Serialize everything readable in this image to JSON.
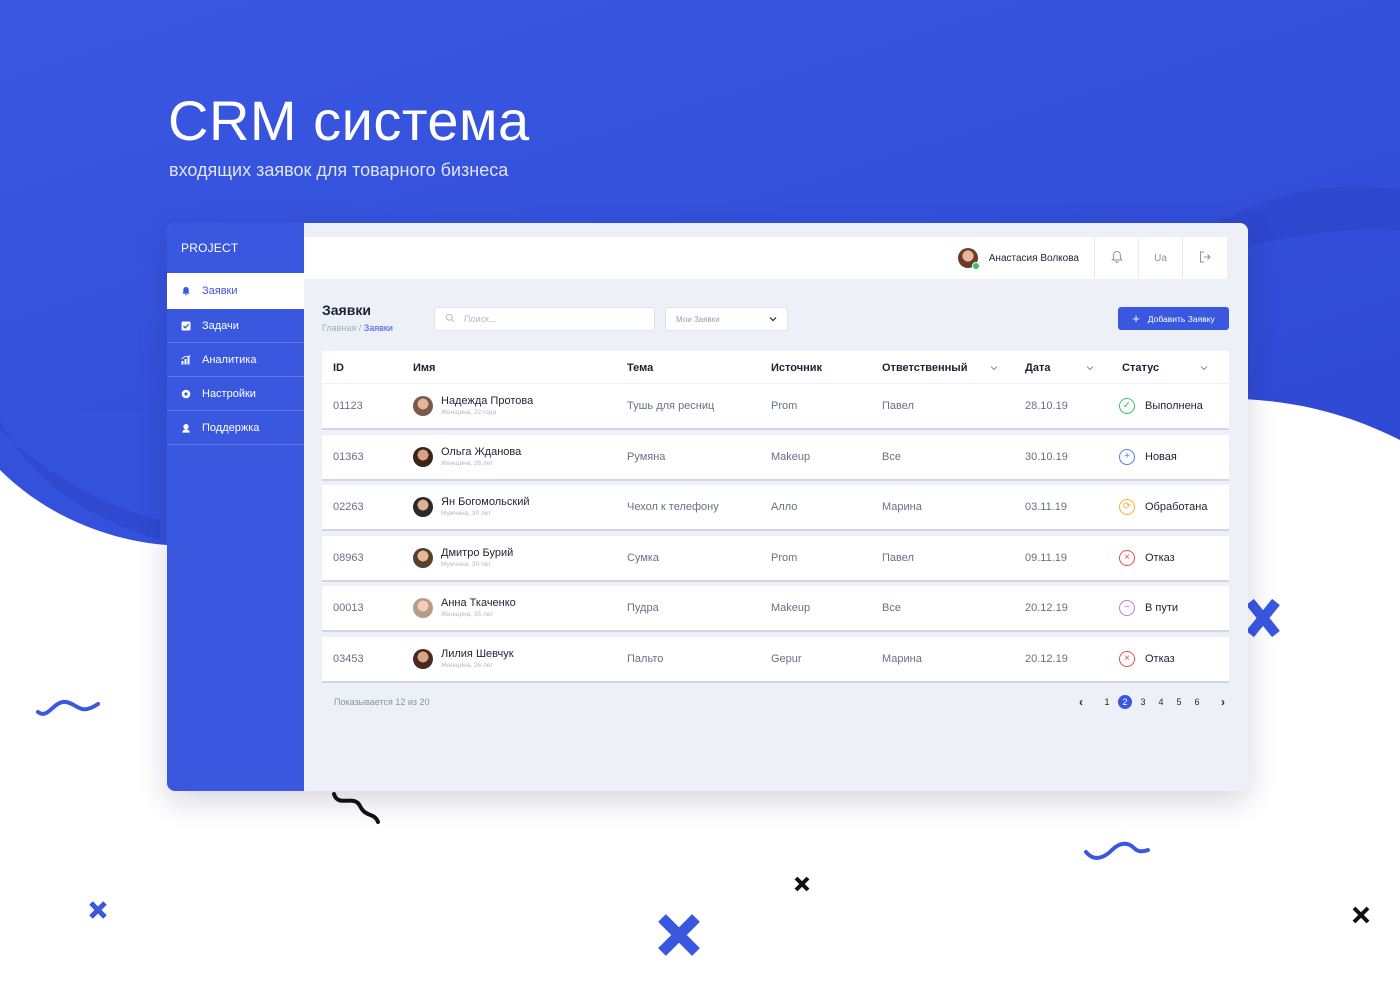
{
  "hero": {
    "title": "CRM система",
    "subtitle": "входящих заявок для товарного бизнеса"
  },
  "colors": {
    "accent": "#3a57e0",
    "background_blue": "#3652dd",
    "status_done": "#33c36b",
    "status_new": "#5b78f0",
    "status_processed": "#f2b233",
    "status_refused": "#ee4b55",
    "status_on_way": "#b37de6"
  },
  "sidebar": {
    "brand": "PROJECT",
    "items": [
      {
        "label": "Заявки",
        "icon": "bell-icon",
        "active": true
      },
      {
        "label": "Задачи",
        "icon": "checkbox-icon",
        "active": false
      },
      {
        "label": "Аналитика",
        "icon": "chart-icon",
        "active": false
      },
      {
        "label": "Настройки",
        "icon": "gear-icon",
        "active": false
      },
      {
        "label": "Поддержка",
        "icon": "support-icon",
        "active": false
      }
    ]
  },
  "topbar": {
    "user_name": "Анастасия Волкова",
    "lang": "Ua",
    "icons": [
      "bell-icon",
      "logout-icon"
    ]
  },
  "page": {
    "title": "Заявки",
    "breadcrumb_home": "Главная",
    "breadcrumb_sep": " / ",
    "breadcrumb_current": "Заявки"
  },
  "search": {
    "placeholder": "Поиск...",
    "value": ""
  },
  "filter": {
    "selected": "Мои Заявки"
  },
  "add_button": {
    "label": "Добавить Заявку"
  },
  "table": {
    "headers": {
      "id": "ID",
      "name": "Имя",
      "topic": "Тема",
      "source": "Источник",
      "responsible": "Ответственный",
      "date": "Дата",
      "status": "Статус"
    },
    "rows": [
      {
        "id": "01123",
        "name": "Надежда Протова",
        "meta": "Женщина, 22 года",
        "topic": "Тушь для ресниц",
        "source": "Prom",
        "responsible": "Павел",
        "date": "28.10.19",
        "status": "Выполнена",
        "status_kind": "done"
      },
      {
        "id": "01363",
        "name": "Ольга Жданова",
        "meta": "Женщина, 26 лет",
        "topic": "Румяна",
        "source": "Makeup",
        "responsible": "Все",
        "date": "30.10.19",
        "status": "Новая",
        "status_kind": "new"
      },
      {
        "id": "02263",
        "name": "Ян Богомольский",
        "meta": "Мужчина, 30 лет",
        "topic": "Чехол к телефону",
        "source": "Алло",
        "responsible": "Марина",
        "date": "03.11.19",
        "status": "Обработана",
        "status_kind": "processed"
      },
      {
        "id": "08963",
        "name": "Дмитро Бурий",
        "meta": "Мужчина, 30 лет",
        "topic": "Сумка",
        "source": "Prom",
        "responsible": "Павел",
        "date": "09.11.19",
        "status": "Отказ",
        "status_kind": "refused"
      },
      {
        "id": "00013",
        "name": "Анна Ткаченко",
        "meta": "Женщина, 35 лет",
        "topic": "Пудра",
        "source": "Makeup",
        "responsible": "Все",
        "date": "20.12.19",
        "status": "В пути",
        "status_kind": "on_way"
      },
      {
        "id": "03453",
        "name": "Лилия Шевчук",
        "meta": "Женщина, 26 лет",
        "topic": "Пальто",
        "source": "Gepur",
        "responsible": "Марина",
        "date": "20.12.19",
        "status": "Отказ",
        "status_kind": "refused"
      }
    ]
  },
  "footer": {
    "shown": "Показывается 12 из 20",
    "pages": [
      "1",
      "2",
      "3",
      "4",
      "5",
      "6"
    ],
    "current_page": "2"
  }
}
